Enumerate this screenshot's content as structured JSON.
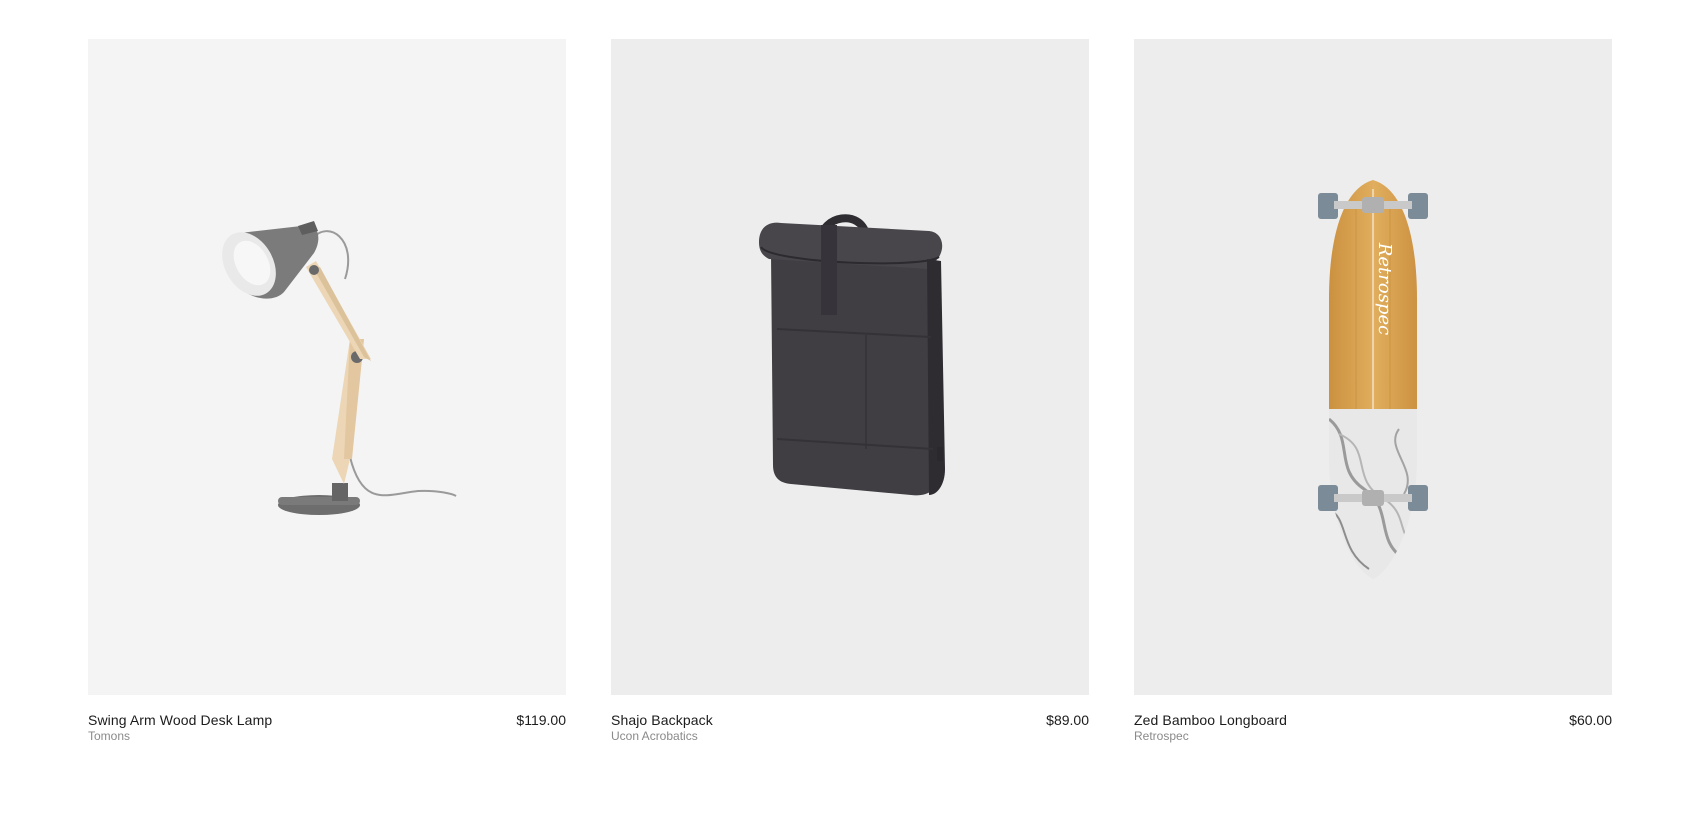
{
  "products": [
    {
      "name": "Swing Arm Wood Desk Lamp",
      "brand": "Tomons",
      "price": "$119.00",
      "image": "desk-lamp",
      "bg": "#f4f4f4"
    },
    {
      "name": "Shajo Backpack",
      "brand": "Ucon Acrobatics",
      "price": "$89.00",
      "image": "backpack",
      "bg": "#ededed"
    },
    {
      "name": "Zed Bamboo Longboard",
      "brand": "Retrospec",
      "price": "$60.00",
      "image": "longboard",
      "bg": "#ededed",
      "image_text": "Retrospec"
    }
  ]
}
